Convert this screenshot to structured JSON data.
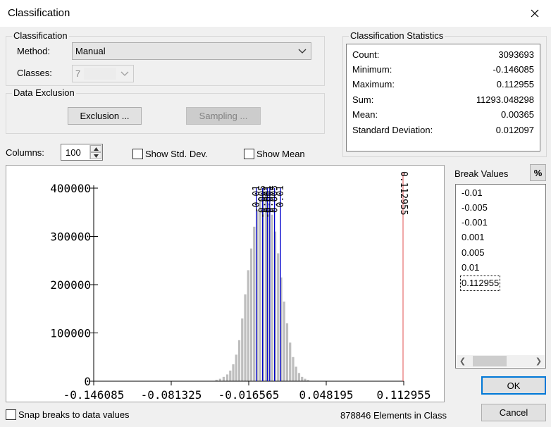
{
  "window": {
    "title": "Classification"
  },
  "classification": {
    "legend": "Classification",
    "method_label": "Method:",
    "method_value": "Manual",
    "classes_label": "Classes:",
    "classes_value": "7"
  },
  "data_exclusion": {
    "legend": "Data Exclusion",
    "exclusion_button": "Exclusion ...",
    "sampling_button": "Sampling ..."
  },
  "statistics": {
    "legend": "Classification Statistics",
    "rows": [
      {
        "label": "Count:",
        "value": "3093693"
      },
      {
        "label": "Minimum:",
        "value": "-0.146085"
      },
      {
        "label": "Maximum:",
        "value": "0.112955"
      },
      {
        "label": "Sum:",
        "value": "11293.048298"
      },
      {
        "label": "Mean:",
        "value": "0.00365"
      },
      {
        "label": "Standard Deviation:",
        "value": "0.012097"
      }
    ]
  },
  "columns": {
    "label": "Columns:",
    "value": "100"
  },
  "options": {
    "show_std_dev": "Show Std. Dev.",
    "show_mean": "Show Mean",
    "snap_breaks": "Snap breaks to data values"
  },
  "break_values": {
    "label": "Break Values",
    "percent_button": "%",
    "items": [
      "-0.01",
      "-0.005",
      "-0.001",
      "0.001",
      "0.005",
      "0.01",
      "0.112955"
    ]
  },
  "status": {
    "elements_in_class": "878846 Elements in Class"
  },
  "buttons": {
    "ok": "OK",
    "cancel": "Cancel"
  },
  "chart_data": {
    "type": "bar",
    "xlim": [
      -0.146085,
      0.112955
    ],
    "ylim": [
      0,
      400000
    ],
    "x_ticks": [
      -0.146085,
      -0.081325,
      -0.016565,
      0.048195,
      0.112955
    ],
    "x_tick_labels": [
      "-0.146085",
      "-0.081325",
      "-0.016565",
      "0.048195",
      "0.112955"
    ],
    "y_ticks": [
      0,
      100000,
      200000,
      300000,
      400000
    ],
    "y_tick_labels": [
      "0",
      "100000",
      "200000",
      "300000",
      "400000"
    ],
    "bins": [
      {
        "x": -0.0435,
        "y": 3000
      },
      {
        "x": -0.0405,
        "y": 5000
      },
      {
        "x": -0.0375,
        "y": 9000
      },
      {
        "x": -0.0345,
        "y": 14000
      },
      {
        "x": -0.032,
        "y": 22000
      },
      {
        "x": -0.0295,
        "y": 35000
      },
      {
        "x": -0.027,
        "y": 55000
      },
      {
        "x": -0.0245,
        "y": 85000
      },
      {
        "x": -0.022,
        "y": 130000
      },
      {
        "x": -0.0195,
        "y": 180000
      },
      {
        "x": -0.017,
        "y": 230000
      },
      {
        "x": -0.0145,
        "y": 275000
      },
      {
        "x": -0.012,
        "y": 320000
      },
      {
        "x": -0.0095,
        "y": 355000
      },
      {
        "x": -0.007,
        "y": 380000
      },
      {
        "x": -0.0045,
        "y": 400000
      },
      {
        "x": -0.002,
        "y": 390000
      },
      {
        "x": 0.0005,
        "y": 370000
      },
      {
        "x": 0.003,
        "y": 345000
      },
      {
        "x": 0.0055,
        "y": 310000
      },
      {
        "x": 0.008,
        "y": 265000
      },
      {
        "x": 0.0105,
        "y": 215000
      },
      {
        "x": 0.013,
        "y": 165000
      },
      {
        "x": 0.0155,
        "y": 120000
      },
      {
        "x": 0.018,
        "y": 80000
      },
      {
        "x": 0.0205,
        "y": 50000
      },
      {
        "x": 0.023,
        "y": 30000
      },
      {
        "x": 0.0255,
        "y": 17000
      },
      {
        "x": 0.028,
        "y": 9000
      },
      {
        "x": 0.0305,
        "y": 5000
      },
      {
        "x": 0.033,
        "y": 2500
      }
    ],
    "break_lines": [
      -0.01,
      -0.005,
      -0.001,
      0.001,
      0.005,
      0.01
    ],
    "break_labels": [
      "-0.01",
      "-0.005",
      "-0.001",
      "0.001",
      "0.005",
      "0.01"
    ],
    "max_line": 0.112955,
    "max_label": "0.112955",
    "colors": {
      "bars": "#bebebe",
      "breaks": "#0000cc",
      "max": "#e05050"
    }
  }
}
